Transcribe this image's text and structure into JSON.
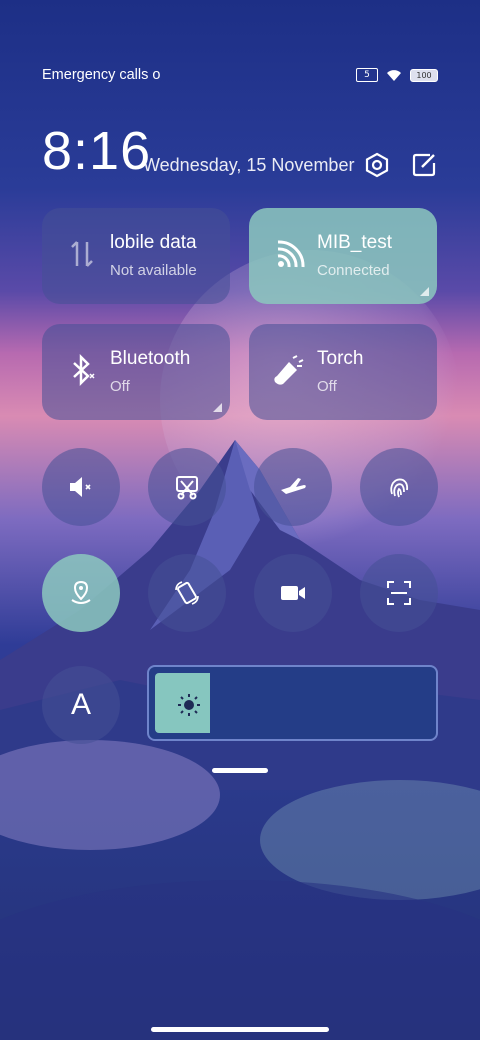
{
  "status_bar": {
    "carrier_text": "Emergency calls o",
    "sim_label": "5",
    "battery_label": "100"
  },
  "clock": {
    "time": "8:16",
    "date": "Wednesday, 15 November"
  },
  "tiles": [
    {
      "name": "lobile data",
      "sub": "Not available",
      "icon": "mobile-data-icon"
    },
    {
      "name": "MIB_test",
      "sub": "Connected",
      "icon": "wifi-icon"
    },
    {
      "name": "Bluetooth",
      "sub": "Off",
      "icon": "bluetooth-icon"
    },
    {
      "name": "Torch",
      "sub": "Off",
      "icon": "torch-icon"
    }
  ],
  "toggles": [
    "mute-icon",
    "screenshot-icon",
    "airplane-icon",
    "fingerprint-icon",
    "location-icon",
    "auto-rotate-icon",
    "screen-record-icon",
    "scan-icon",
    "font-size-icon"
  ],
  "font_button": {
    "label": "A"
  },
  "brightness": {
    "level": 0.2
  },
  "colors": {
    "active": "#86c6bf",
    "tile": "#46509a"
  }
}
